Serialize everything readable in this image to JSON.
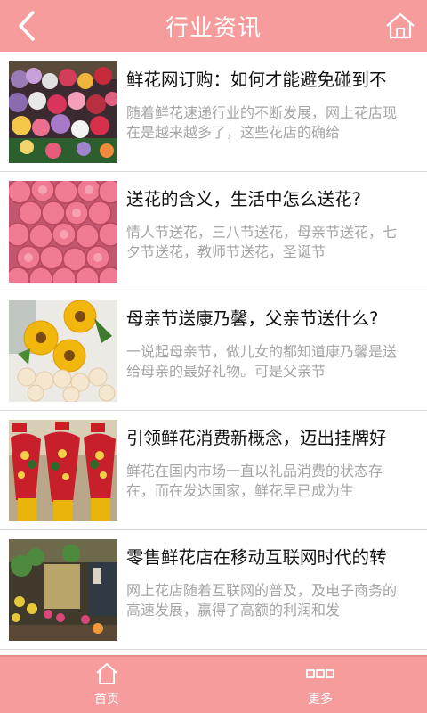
{
  "header": {
    "title": "行业资讯",
    "back_icon": "chevron-left-icon",
    "home_icon": "home-icon"
  },
  "articles": [
    {
      "title": "鲜花网订购：如何才能避免碰到不",
      "desc": "随着鲜花速递行业的不断发展，网上花店现在是越来越多了，这些花店的确给",
      "image": "flower-market-photo"
    },
    {
      "title": "送花的含义，生活中怎么送花?",
      "desc": "情人节送花，三八节送花，母亲节送花，七夕节送花，教师节送花，圣诞节",
      "image": "pink-roses-photo"
    },
    {
      "title": "母亲节送康乃馨，父亲节送什么?",
      "desc": "一说起母亲节，做儿女的都知道康乃馨是送给母亲的最好礼物。可是父亲节",
      "image": "sunflower-bouquet-photo"
    },
    {
      "title": "引领鲜花消费新概念，迈出挂牌好",
      "desc": "鲜花在国内市场一直以礼品消费的状态存在，而在发达国家，鲜花早已成为生",
      "image": "flower-baskets-photo"
    },
    {
      "title": "零售鲜花店在移动互联网时代的转",
      "desc": "网上花店随着互联网的普及，及电子商务的高速发展，赢得了高额的利润和发",
      "image": "flower-shop-photo"
    }
  ],
  "bottom_nav": [
    {
      "label": "首页",
      "icon": "home-icon"
    },
    {
      "label": "更多",
      "icon": "more-icon"
    }
  ],
  "colors": {
    "accent": "#f79c9c",
    "title_text": "#111111",
    "desc_text": "#a5a5a5"
  }
}
